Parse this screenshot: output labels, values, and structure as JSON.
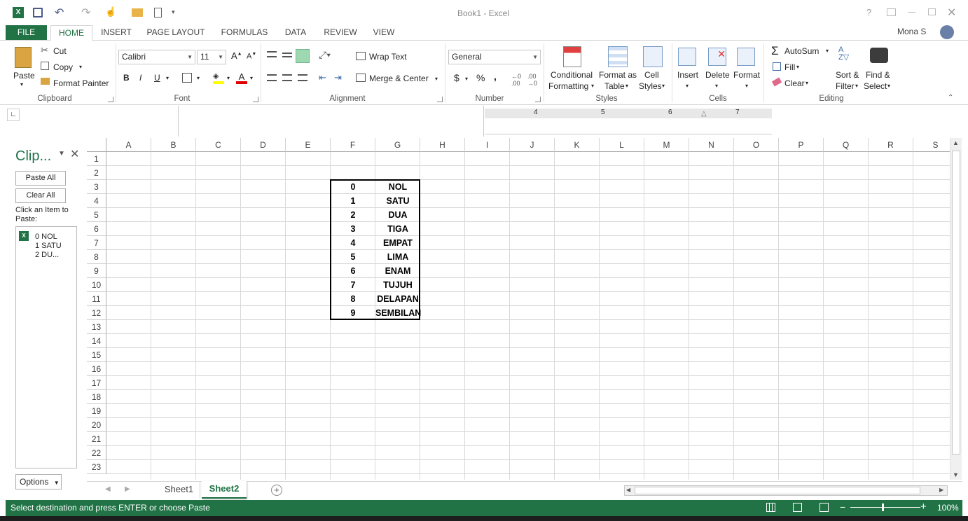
{
  "window": {
    "title": "Book1 - Excel",
    "user": "Mona S"
  },
  "tabs": [
    "FILE",
    "HOME",
    "INSERT",
    "PAGE LAYOUT",
    "FORMULAS",
    "DATA",
    "REVIEW",
    "VIEW"
  ],
  "ribbon": {
    "clipboard": {
      "paste": "Paste",
      "cut": "Cut",
      "copy": "Copy",
      "format_painter": "Format Painter",
      "label": "Clipboard"
    },
    "font": {
      "name": "Calibri",
      "size": "11",
      "bold": "B",
      "italic": "I",
      "underline": "U",
      "label": "Font"
    },
    "alignment": {
      "wrap": "Wrap Text",
      "merge": "Merge & Center",
      "label": "Alignment"
    },
    "number": {
      "format": "General",
      "currency": "$",
      "percent": "%",
      "comma": ",",
      "label": "Number"
    },
    "styles": {
      "conditional": "Conditional",
      "formatting": "Formatting",
      "format_as": "Format as",
      "table": "Table",
      "cell": "Cell",
      "styles_word": "Styles",
      "label": "Styles"
    },
    "cells": {
      "insert": "Insert",
      "delete": "Delete",
      "format": "Format",
      "label": "Cells"
    },
    "editing": {
      "autosum": "AutoSum",
      "fill": "Fill",
      "clear": "Clear",
      "sort": "Sort &",
      "filter": "Filter",
      "find": "Find &",
      "select": "Select",
      "label": "Editing"
    }
  },
  "clipboard_pane": {
    "title": "Clip...",
    "paste_all": "Paste All",
    "clear_all": "Clear All",
    "hint": "Click an Item to Paste:",
    "item_lines": [
      "0 NOL",
      "1 SATU",
      "2 DU..."
    ],
    "options": "Options"
  },
  "ruler": {
    "marks": [
      "4",
      "5",
      "6",
      "7"
    ]
  },
  "grid": {
    "columns": [
      "A",
      "B",
      "C",
      "D",
      "E",
      "F",
      "G",
      "H",
      "I",
      "J",
      "K",
      "L",
      "M",
      "N",
      "O",
      "P",
      "Q",
      "R",
      "S"
    ],
    "rows": [
      "1",
      "2",
      "3",
      "4",
      "5",
      "6",
      "7",
      "8",
      "9",
      "10",
      "11",
      "12",
      "13",
      "14",
      "15",
      "16",
      "17",
      "18",
      "19",
      "20",
      "21",
      "22",
      "23"
    ],
    "data": [
      [
        "0",
        "NOL"
      ],
      [
        "1",
        "SATU"
      ],
      [
        "2",
        "DUA"
      ],
      [
        "3",
        "TIGA"
      ],
      [
        "4",
        "EMPAT"
      ],
      [
        "5",
        "LIMA"
      ],
      [
        "6",
        "ENAM"
      ],
      [
        "7",
        "TUJUH"
      ],
      [
        "8",
        "DELAPAN"
      ],
      [
        "9",
        "SEMBILAN"
      ]
    ]
  },
  "sheets": [
    "Sheet1",
    "Sheet2"
  ],
  "active_sheet": "Sheet2",
  "status": {
    "message": "Select destination and press ENTER or choose Paste",
    "zoom": "100%"
  },
  "colors": {
    "accent": "#217346"
  }
}
